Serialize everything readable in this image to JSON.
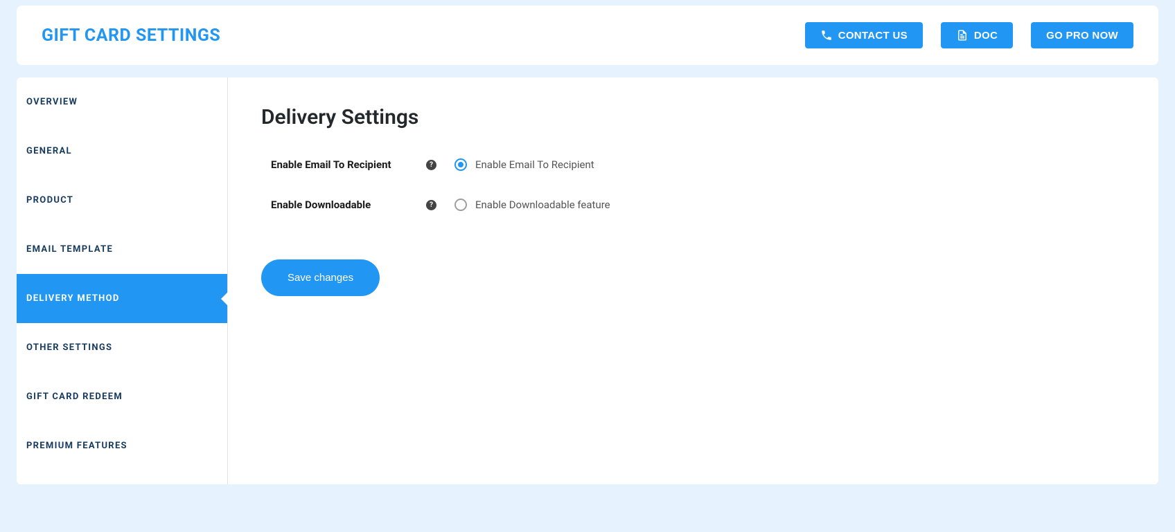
{
  "header": {
    "title": "GIFT CARD SETTINGS",
    "buttons": {
      "contact": "CONTACT US",
      "doc": "DOC",
      "pro": "GO PRO NOW"
    }
  },
  "sidebar": {
    "items": [
      {
        "label": "OVERVIEW",
        "active": false
      },
      {
        "label": "GENERAL",
        "active": false
      },
      {
        "label": "PRODUCT",
        "active": false
      },
      {
        "label": "EMAIL TEMPLATE",
        "active": false
      },
      {
        "label": "DELIVERY METHOD",
        "active": true
      },
      {
        "label": "OTHER SETTINGS",
        "active": false
      },
      {
        "label": "GIFT CARD REDEEM",
        "active": false
      },
      {
        "label": "PREMIUM FEATURES",
        "active": false
      }
    ]
  },
  "main": {
    "section_title": "Delivery Settings",
    "rows": [
      {
        "label": "Enable Email To Recipient",
        "option_label": "Enable Email To Recipient",
        "checked": true
      },
      {
        "label": "Enable Downloadable",
        "option_label": "Enable Downloadable feature",
        "checked": false
      }
    ],
    "save_label": "Save changes"
  },
  "colors": {
    "primary": "#2196f3",
    "page_bg": "#e6f3ff",
    "sidebar_text": "#163a5f"
  }
}
